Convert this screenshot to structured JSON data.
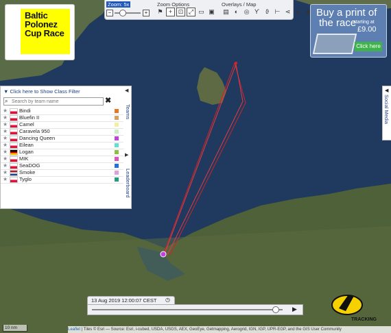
{
  "toolbar": {
    "zoom_label": "Zoom: 5x",
    "zoom_options_label": "Zoom Options",
    "overlays_label": "Overlays / Map",
    "zoom_level": 0.3
  },
  "logo": {
    "text": "Baltic\nPolonez\nCup Race",
    "color": "#ffff00"
  },
  "buy_print": {
    "title": "Buy a print of",
    "subtitle": "the race",
    "starting_at": "starting at",
    "price": "£9.00",
    "click": "Click here"
  },
  "panel": {
    "class_filter": "Click here to Show Class Filter",
    "search_placeholder": "Search by team name",
    "teams_tab": "Teams",
    "leaderboard_tab": "Leaderboard",
    "teams": [
      {
        "name": "Bindi",
        "flag": "pl",
        "color": "#e87722"
      },
      {
        "name": "Bluefin II",
        "flag": "pl",
        "color": "#d8a060"
      },
      {
        "name": "Camel",
        "flag": "pl",
        "color": "#f0f0a0"
      },
      {
        "name": "Caravela 950",
        "flag": "pl",
        "color": "#c7f0c0"
      },
      {
        "name": "Dancing Queen",
        "flag": "pl",
        "color": "#c040e0"
      },
      {
        "name": "Eilean",
        "flag": "pl",
        "color": "#60e0d0"
      },
      {
        "name": "Logan",
        "flag": "de",
        "color": "#8cc040"
      },
      {
        "name": "MIK",
        "flag": "pl",
        "color": "#e050c0"
      },
      {
        "name": "SeaDOG",
        "flag": "pl",
        "color": "#2070e0"
      },
      {
        "name": "Smoke",
        "flag": "nl",
        "color": "#e0a0e0"
      },
      {
        "name": "Tyglo",
        "flag": "pl",
        "color": "#20a080"
      }
    ]
  },
  "social_tab": "Social Media",
  "timeline": {
    "time": "13 Aug 2019 12:00:07 CEST",
    "progress": 0.96
  },
  "scale": "10 nm",
  "attribution": {
    "leaflet": "Leaflet",
    "text": " | Tiles © Esri — Source: Esri, i-cubed, USDA, USGS, AEX, GeoEye, Getmapping, Aerogrid, IGN, IGP, UPR-EGP, and the GIS User Community"
  },
  "yb_logo_text": "TRACKING"
}
